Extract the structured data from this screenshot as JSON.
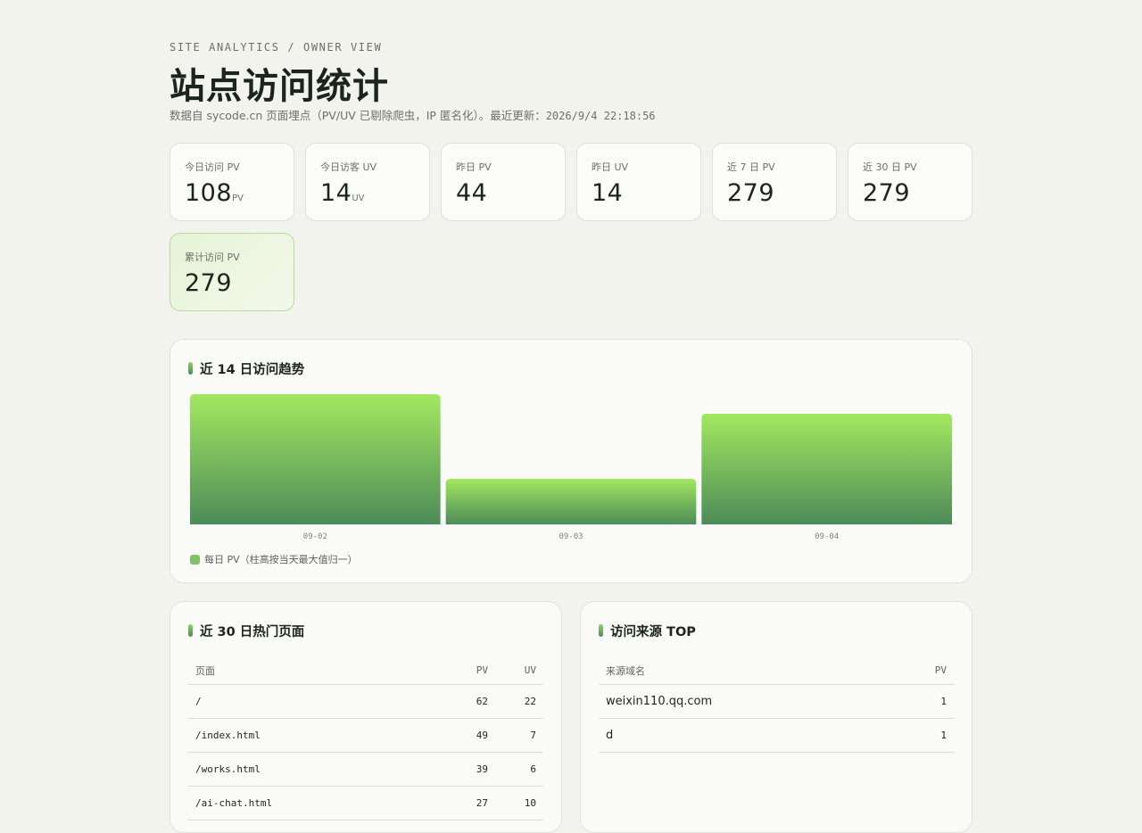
{
  "header": {
    "eyebrow": "SITE ANALYTICS / OWNER VIEW",
    "title": "站点访问统计",
    "subtitle_text": "数据自 sycode.cn 页面埋点（PV/UV 已剔除爬虫，IP 匿名化）。最近更新：",
    "updated_at": "2026/9/4 22:18:56"
  },
  "stats": [
    {
      "label": "今日访问 PV",
      "value": "108",
      "unit": "PV"
    },
    {
      "label": "今日访客 UV",
      "value": "14",
      "unit": "UV"
    },
    {
      "label": "昨日 PV",
      "value": "44",
      "unit": ""
    },
    {
      "label": "昨日 UV",
      "value": "14",
      "unit": ""
    },
    {
      "label": "近 7 日 PV",
      "value": "279",
      "unit": ""
    },
    {
      "label": "近 30 日 PV",
      "value": "279",
      "unit": ""
    },
    {
      "label": "累计访问 PV",
      "value": "279",
      "unit": "",
      "highlight": true
    }
  ],
  "trend": {
    "title": "近 14 日访问趋势",
    "legend": "每日 PV（柱高按当天最大值归一）",
    "colors": {
      "bar_top": "#a3e860",
      "bar_bottom": "#4d8b58"
    }
  },
  "chart_data": {
    "type": "bar",
    "categories": [
      "09-02",
      "09-03",
      "09-04"
    ],
    "values": [
      1.0,
      0.35,
      0.85
    ],
    "ylim": [
      0,
      1
    ],
    "grid": false,
    "legend_position": "bottom-left"
  },
  "top_pages": {
    "title": "近 30 日热门页面",
    "columns": [
      "页面",
      "PV",
      "UV"
    ],
    "rows": [
      {
        "page": "/",
        "pv": "62",
        "uv": "22"
      },
      {
        "page": "/index.html",
        "pv": "49",
        "uv": "7"
      },
      {
        "page": "/works.html",
        "pv": "39",
        "uv": "6"
      },
      {
        "page": "/ai-chat.html",
        "pv": "27",
        "uv": "10"
      }
    ]
  },
  "referrers": {
    "title": "访问来源 TOP",
    "columns": [
      "来源域名",
      "PV"
    ],
    "rows": [
      {
        "domain": "weixin110.qq.com",
        "pv": "1"
      },
      {
        "domain": "d",
        "pv": "1"
      }
    ]
  }
}
